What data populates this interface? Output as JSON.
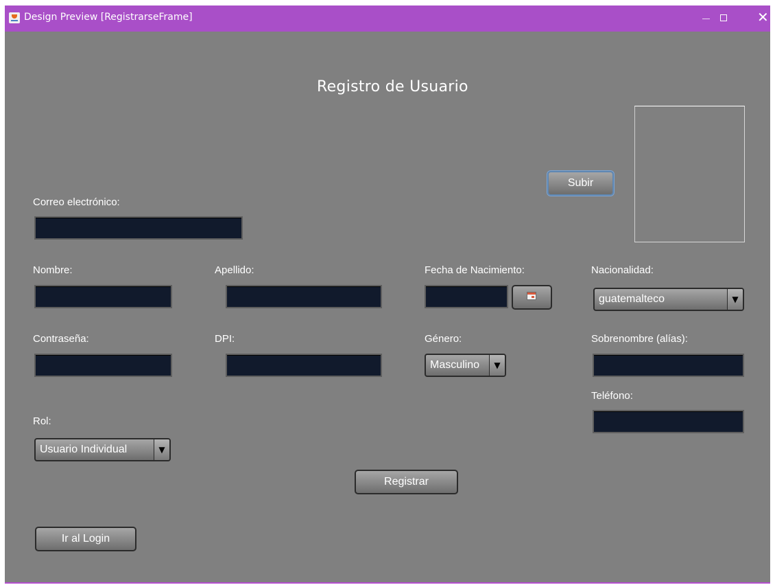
{
  "window": {
    "title": "Design Preview [RegistrarseFrame]",
    "controls": {
      "minimize": "—",
      "maximize": "□",
      "close": "✕"
    },
    "accent_color": "#a94fc8",
    "background_color": "#808080"
  },
  "form": {
    "title": "Registro de Usuario",
    "labels": {
      "correo": "Correo electrónico:",
      "nombre": "Nombre:",
      "apellido": "Apellido:",
      "fecha": "Fecha de Nacimiento:",
      "nacionalidad": "Nacionalidad:",
      "contrasena": "Contraseña:",
      "dpi": "DPI:",
      "genero": "Género:",
      "sobrenombre": "Sobrenombre (alías):",
      "telefono": "Teléfono:",
      "rol": "Rol:"
    },
    "values": {
      "correo": "",
      "nombre": "",
      "apellido": "",
      "fecha": "",
      "contrasena": "",
      "dpi": "",
      "sobrenombre": "",
      "telefono": ""
    },
    "selects": {
      "nacionalidad": "guatemalteco",
      "genero": "Masculino",
      "rol": "Usuario Individual"
    },
    "buttons": {
      "subir": "Subir",
      "registrar": "Registrar",
      "ir_login": "Ir al Login"
    },
    "icons": {
      "calendar": "calendar-icon",
      "dropdown": "triangle-down-icon",
      "app": "java-cup-icon"
    },
    "field_color": "#111a2c"
  }
}
